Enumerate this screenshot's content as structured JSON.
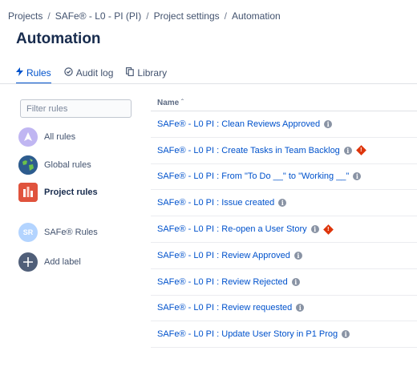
{
  "breadcrumb": [
    {
      "label": "Projects"
    },
    {
      "label": "SAFe® - L0 - PI (PI)"
    },
    {
      "label": "Project settings"
    },
    {
      "label": "Automation"
    }
  ],
  "breadcrumb_separator": "/",
  "page_title": "Automation",
  "tabs": [
    {
      "label": "Rules",
      "icon": "lightning-icon",
      "active": true
    },
    {
      "label": "Audit log",
      "icon": "check-circle-icon",
      "active": false
    },
    {
      "label": "Library",
      "icon": "copy-icon",
      "active": false
    }
  ],
  "sidebar": {
    "filter_placeholder": "Filter rules",
    "items": [
      {
        "label": "All rules",
        "icon": "all-rules-icon"
      },
      {
        "label": "Global rules",
        "icon": "globe-icon"
      },
      {
        "label": "Project rules",
        "icon": "project-icon"
      },
      {
        "label": "SAFe® Rules",
        "avatar_text": "SR"
      },
      {
        "label": "Add label",
        "icon": "plus-icon"
      }
    ]
  },
  "table": {
    "column_header": "Name",
    "sort_indicator": "ˆ",
    "rows": [
      {
        "name": "SAFe® - L0 PI : Clean Reviews Approved",
        "warning": false
      },
      {
        "name": "SAFe® - L0 PI : Create Tasks in Team Backlog",
        "warning": true
      },
      {
        "name": "SAFe® - L0 PI : From \"To Do __\" to \"Working __\"",
        "warning": false
      },
      {
        "name": "SAFe® - L0 PI : Issue created",
        "warning": false
      },
      {
        "name": "SAFe® - L0 PI : Re-open a User Story",
        "warning": true
      },
      {
        "name": "SAFe® - L0 PI : Review Approved",
        "warning": false
      },
      {
        "name": "SAFe® - L0 PI : Review Rejected",
        "warning": false
      },
      {
        "name": "SAFe® - L0 PI : Review requested",
        "warning": false
      },
      {
        "name": "SAFe® - L0 PI : Update User Story in P1 Prog",
        "warning": false
      }
    ]
  },
  "colors": {
    "link": "#0052CC",
    "text": "#172B4D",
    "warning": "#DE350B",
    "info": "#8993A4"
  }
}
